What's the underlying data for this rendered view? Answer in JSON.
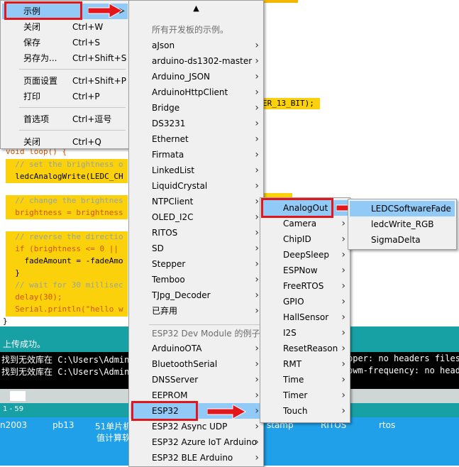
{
  "editor": {
    "lines": [
      {
        "text": "void loop() {"
      },
      {
        "text": "  // set the brightness o"
      },
      {
        "text": "  ledcAnalogWrite(LEDC_CH"
      },
      {
        "text": "  // change the brightnes"
      },
      {
        "text": "  brightness = brightness"
      },
      {
        "text": "  // reverse the directio"
      },
      {
        "text": "  if (brightness <= 0 || "
      },
      {
        "text": "    fadeAmount = -fadeAmo"
      },
      {
        "text": "  }"
      },
      {
        "text": "  // wait for 30 millisec"
      },
      {
        "text": "  delay(30);"
      },
      {
        "text": "  Serial.println(\"hello w"
      }
    ],
    "partial": "ER_13_BIT);",
    "brace": "}"
  },
  "status": {
    "text": "上传成功。"
  },
  "console": {
    "line1_left": "找到无效库在 C:\\Users\\Admini",
    "line1_right": "pper: no headers files",
    "line2_left": "找到无效库在 C:\\Users\\Admini",
    "line2_right": "pwm-frequency: no head"
  },
  "line_range": "1 - 59",
  "taskbar": {
    "items": [
      "n2003",
      "pb13",
      "51单片机",
      "值计算软",
      "stamp",
      "RITOS",
      "rtos"
    ]
  },
  "file_menu": {
    "items": [
      {
        "label": "示例",
        "shortcut": ""
      },
      {
        "label": "关闭",
        "shortcut": "Ctrl+W"
      },
      {
        "label": "保存",
        "shortcut": "Ctrl+S"
      },
      {
        "label": "另存为...",
        "shortcut": "Ctrl+Shift+S"
      },
      {
        "label": "页面设置",
        "shortcut": "Ctrl+Shift+P"
      },
      {
        "label": "打印",
        "shortcut": "Ctrl+P"
      },
      {
        "label": "首选项",
        "shortcut": "Ctrl+逗号"
      },
      {
        "label": "关闭",
        "shortcut": "Ctrl+Q"
      }
    ]
  },
  "examples_menu": {
    "scroll_up": "▲",
    "header_all": "所有开发板的示例。",
    "items": [
      "aJson",
      "arduino-ds1302-master",
      "Arduino_JSON",
      "ArduinoHttpClient",
      "Bridge",
      "DS3231",
      "Ethernet",
      "Firmata",
      "LinkedList",
      "LiquidCrystal",
      "NTPClient",
      "OLED_I2C",
      "RITOS",
      "SD",
      "Stepper",
      "Temboo",
      "TJpg_Decoder",
      "已弃用"
    ],
    "header_board": "ESP32 Dev Module 的例子",
    "board_items": [
      "ArduinoOTA",
      "BluetoothSerial",
      "DNSServer",
      "EEPROM",
      "ESP32",
      "ESP32 Async UDP",
      "ESP32 Azure IoT Arduino",
      "ESP32 BLE Arduino"
    ]
  },
  "esp32_menu": {
    "items": [
      "AnalogOut",
      "Camera",
      "ChipID",
      "DeepSleep",
      "ESPNow",
      "FreeRTOS",
      "GPIO",
      "HallSensor",
      "I2S",
      "ResetReason",
      "RMT",
      "Time",
      "Timer",
      "Touch"
    ]
  },
  "analogout_menu": {
    "items": [
      "LEDCSoftwareFade",
      "ledcWrite_RGB",
      "SigmaDelta"
    ]
  },
  "colors": {
    "accent_red": "#e3161c",
    "selection": "#91c9f7",
    "teal": "#17a1a5"
  }
}
